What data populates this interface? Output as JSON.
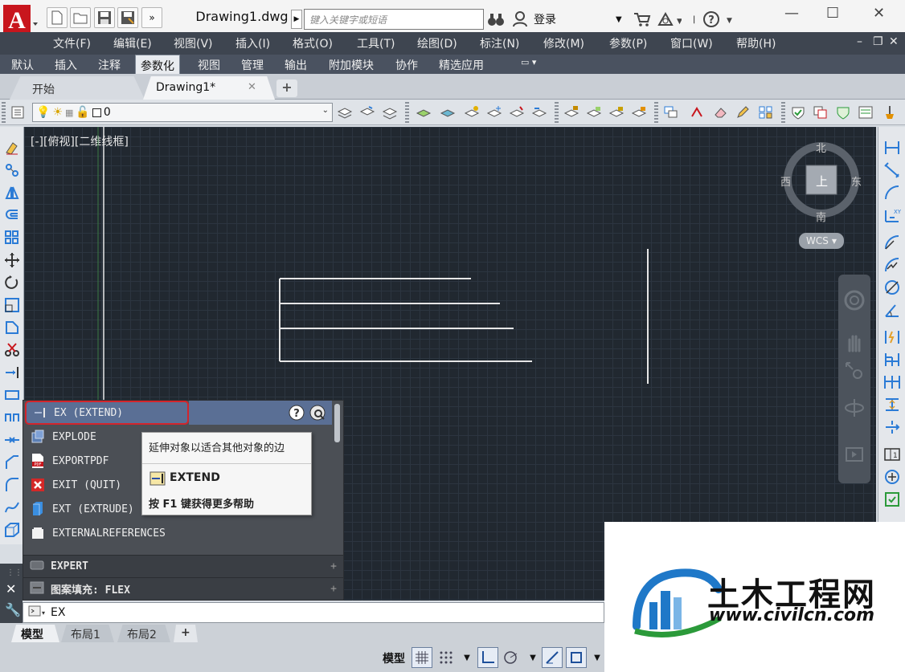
{
  "title_bar": {
    "doc_title": "Drawing1.dwg",
    "search_placeholder": "键入关键字或短语",
    "login_label": "登录"
  },
  "menu_bar": {
    "items": [
      "文件(F)",
      "编辑(E)",
      "视图(V)",
      "插入(I)",
      "格式(O)",
      "工具(T)",
      "绘图(D)",
      "标注(N)",
      "修改(M)",
      "参数(P)",
      "窗口(W)",
      "帮助(H)"
    ]
  },
  "ribbon_tabs": {
    "items": [
      "默认",
      "插入",
      "注释",
      "参数化",
      "视图",
      "管理",
      "输出",
      "附加模块",
      "协作",
      "精选应用"
    ],
    "active": "参数化"
  },
  "file_tabs": {
    "start": "开始",
    "drawing": "Drawing1*",
    "close_glyph": "✕",
    "add_glyph": "+"
  },
  "layer_bar": {
    "current_layer": "0"
  },
  "viewport": {
    "label": "[-][俯视][二维线框]",
    "viewcube": {
      "north": "北",
      "south": "南",
      "east": "东",
      "west": "西",
      "face": "上",
      "ucs": "WCS"
    }
  },
  "autocomplete": {
    "items": [
      {
        "label": "EX (EXTEND)",
        "icon": "extend-icon"
      },
      {
        "label": "EXPLODE",
        "icon": "explode-icon"
      },
      {
        "label": "EXPORTPDF",
        "icon": "pdf-icon"
      },
      {
        "label": "EXIT (QUIT)",
        "icon": "exit-icon"
      },
      {
        "label": "EXT (EXTRUDE)",
        "icon": "extrude-icon"
      },
      {
        "label": "EXTERNALREFERENCES",
        "icon": "xref-icon"
      }
    ],
    "categories": [
      {
        "label": "EXPERT",
        "icon": "variable-icon"
      },
      {
        "label": "图案填充: FLEX",
        "icon": "hatch-icon"
      }
    ],
    "tooltip": {
      "description": "延伸对象以适合其他对象的边",
      "command": "EXTEND",
      "help": "按 F1 键获得更多帮助"
    }
  },
  "command_line": {
    "text": "EX"
  },
  "layout_tabs": {
    "items": [
      "模型",
      "布局1",
      "布局2"
    ],
    "active": "模型",
    "add_glyph": "+"
  },
  "status_bar": {
    "model_label": "模型"
  },
  "watermark": {
    "title": "土木工程网",
    "url": "www.civilcn.com"
  },
  "colors": {
    "canvas_bg": "#212830",
    "menu_bg": "#3e4550",
    "selection": "#5a6f95",
    "highlight_border": "#d3252b",
    "autocad_red": "#c8161d"
  }
}
